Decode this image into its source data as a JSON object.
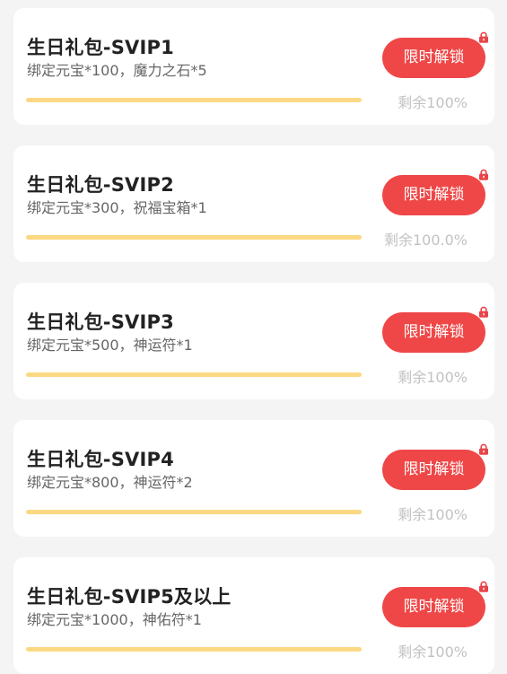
{
  "colors": {
    "accent_button": "#ef4747",
    "progress_bar": "#fbd984",
    "lock_icon": "#e8444a",
    "card_background": "#ffffff",
    "page_background": "#f4f4f4"
  },
  "gifts": [
    {
      "title": "生日礼包-SVIP1",
      "desc": "绑定元宝*100，魔力之石*5",
      "button_label": "限时解锁",
      "remaining": "剩余100%",
      "progress_percent": 100,
      "icon": "lock-icon"
    },
    {
      "title": "生日礼包-SVIP2",
      "desc": "绑定元宝*300，祝福宝箱*1",
      "button_label": "限时解锁",
      "remaining": "剩余100.0%",
      "progress_percent": 100,
      "icon": "lock-icon"
    },
    {
      "title": "生日礼包-SVIP3",
      "desc": "绑定元宝*500，神运符*1",
      "button_label": "限时解锁",
      "remaining": "剩余100%",
      "progress_percent": 100,
      "icon": "lock-icon"
    },
    {
      "title": "生日礼包-SVIP4",
      "desc": "绑定元宝*800，神运符*2",
      "button_label": "限时解锁",
      "remaining": "剩余100%",
      "progress_percent": 100,
      "icon": "lock-icon"
    },
    {
      "title": "生日礼包-SVIP5及以上",
      "desc": "绑定元宝*1000，神佑符*1",
      "button_label": "限时解锁",
      "remaining": "剩余100%",
      "progress_percent": 100,
      "icon": "lock-icon"
    }
  ]
}
